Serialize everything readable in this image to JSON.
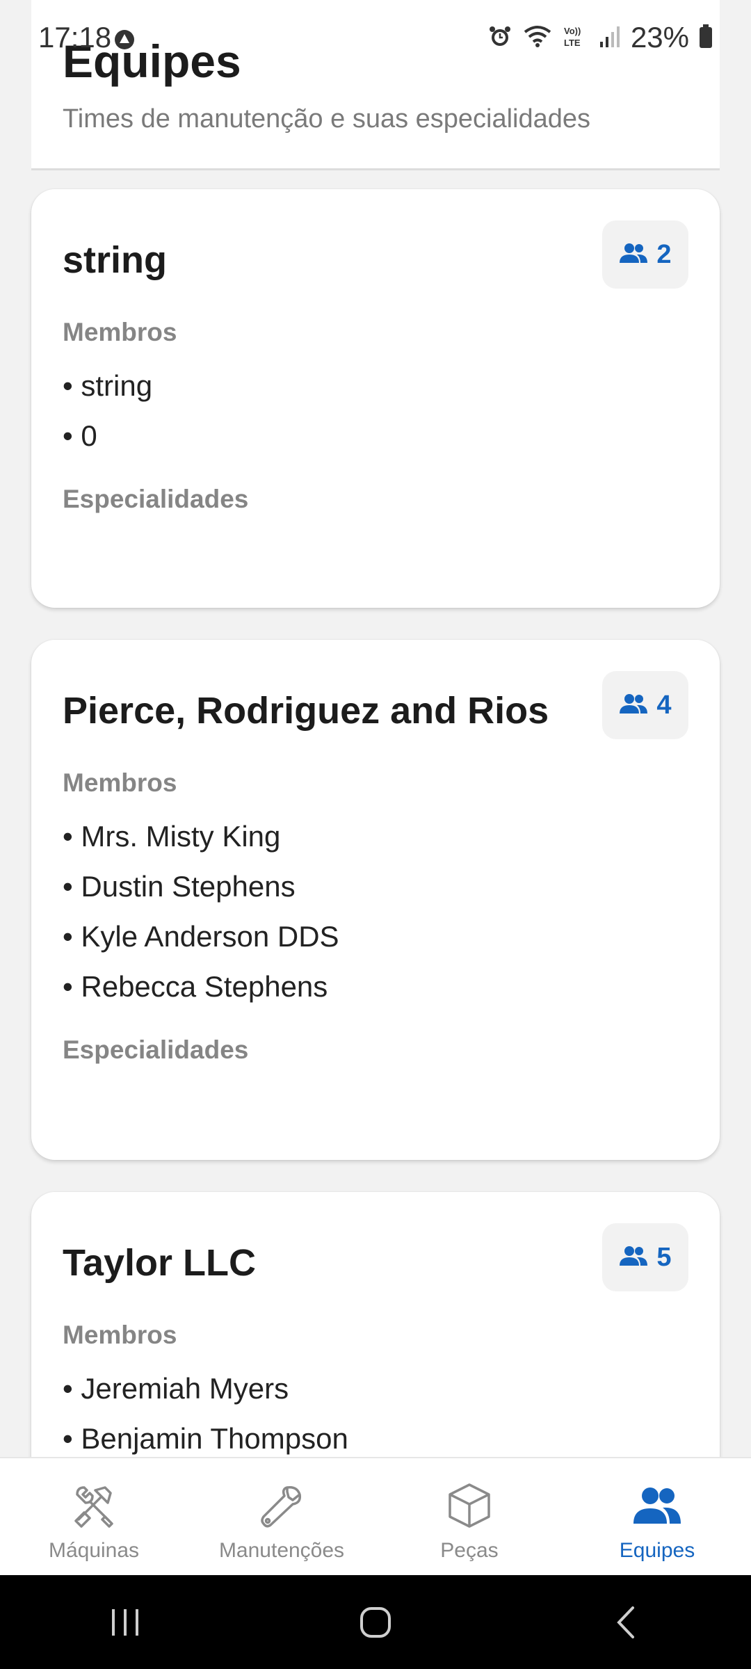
{
  "status": {
    "time": "17:18",
    "battery": "23%"
  },
  "header": {
    "title": "Equipes",
    "subtitle": "Times de manutenção e suas especialidades"
  },
  "labels": {
    "members": "Membros",
    "specialties": "Especialidades"
  },
  "teams": [
    {
      "name": "string",
      "member_count": "2",
      "members": [
        "• string",
        "• 0"
      ]
    },
    {
      "name": "Pierce, Rodriguez and Rios",
      "member_count": "4",
      "members": [
        "• Mrs. Misty King",
        "• Dustin Stephens",
        "• Kyle Anderson DDS",
        "• Rebecca Stephens"
      ]
    },
    {
      "name": "Taylor LLC",
      "member_count": "5",
      "members": [
        "• Jeremiah Myers",
        "• Benjamin Thompson"
      ]
    }
  ],
  "nav": {
    "items": [
      {
        "label": "Máquinas",
        "icon": "hammer-wrench-icon"
      },
      {
        "label": "Manutenções",
        "icon": "wrench-icon"
      },
      {
        "label": "Peças",
        "icon": "cube-icon"
      },
      {
        "label": "Equipes",
        "icon": "people-icon"
      }
    ],
    "active": "Equipes"
  },
  "colors": {
    "accent": "#1565c0",
    "background": "#f2f2f2",
    "card": "#ffffff",
    "muted": "#858585"
  }
}
